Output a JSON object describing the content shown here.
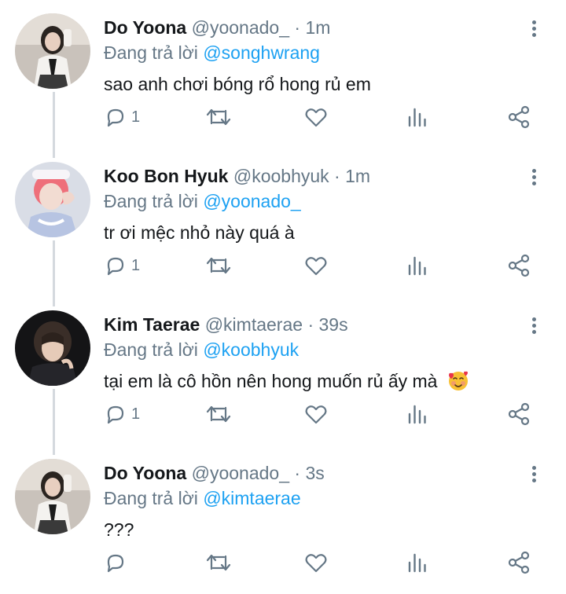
{
  "colors": {
    "accent": "#1da1f2",
    "secondary_text": "#657786",
    "thread_line": "#d4d9de"
  },
  "reply_prefix": "Đang trả lời",
  "tweets": [
    {
      "name": "Do Yoona",
      "handle": "@yoonado_",
      "time": "· 1m",
      "reply_to": "@songhwrang",
      "text": "sao anh chơi bóng rổ hong rủ em",
      "reply_count": "1",
      "avatar": "avatar-girl-mirror-selfie"
    },
    {
      "name": "Koo Bon Hyuk",
      "handle": "@koobhyuk",
      "time": "· 1m",
      "reply_to": "@yoonado_",
      "text": "tr ơi mệc nhỏ này quá à",
      "reply_count": "1",
      "avatar": "avatar-pink-hair-boy"
    },
    {
      "name": "Kim Taerae",
      "handle": "@kimtaerae",
      "time": "· 39s",
      "reply_to": "@koobhyuk",
      "text": "tại em là cô hồn nên hong muốn rủ ấy mà",
      "reply_count": "1",
      "avatar": "avatar-dark-hair-boy",
      "emoji": "smiling-face-with-hearts-emoji"
    },
    {
      "name": "Do Yoona",
      "handle": "@yoonado_",
      "time": "· 3s",
      "reply_to": "@kimtaerae",
      "text": "???",
      "reply_count": "",
      "avatar": "avatar-girl-mirror-selfie"
    }
  ],
  "icons": [
    "reply-icon",
    "retweet-icon",
    "like-icon",
    "analytics-icon",
    "share-icon",
    "more-options-icon"
  ]
}
